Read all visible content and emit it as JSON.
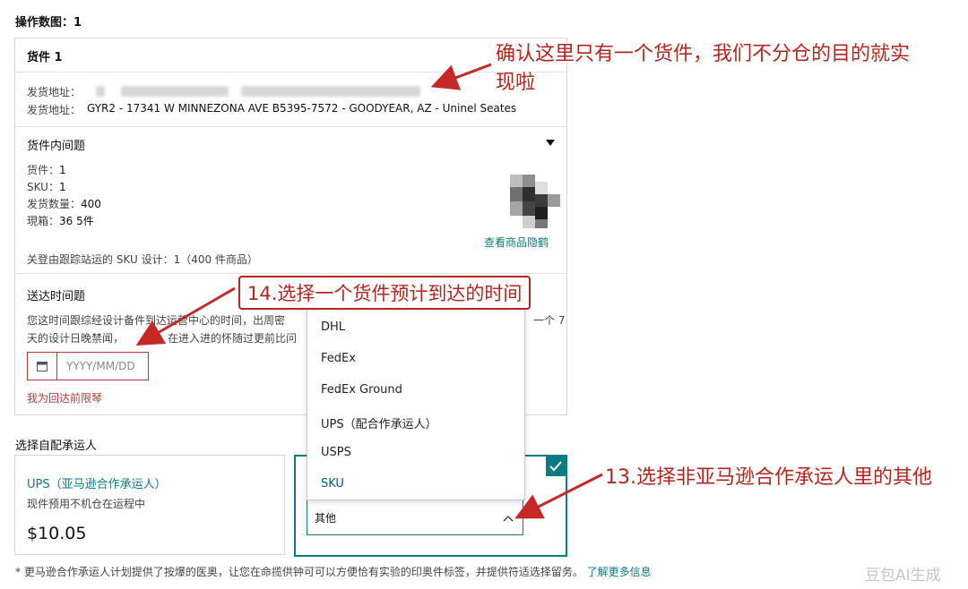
{
  "header": {
    "operate_title": "操作数图：1"
  },
  "shipment": {
    "title": "货件 1",
    "from_label": "发货地址：",
    "to_label": "发货地址：",
    "to_address": "GYR2 - 17341 W MINNEZONA AVE  B5395-7572 - GOODYEAR, AZ - Uninel Seates"
  },
  "contents": {
    "title": "货件内间题",
    "rows": [
      {
        "label": "货件：",
        "value": "1"
      },
      {
        "label": "SKU：",
        "value": "1"
      },
      {
        "label": "发货数量：",
        "value": "400"
      },
      {
        "label": "現箱：",
        "value": "36 5件"
      }
    ],
    "view_link": "查看商品隐鹤",
    "note": "关登由跟踪站运的 SKU 设计：1（400 件商品）"
  },
  "delivery": {
    "title": "送达时间题",
    "desc_line1": "您这时间跟综经设计备件到达运营中心的时间，出周密",
    "desc_line2": "天的设计日晚禁闻，",
    "desc_line2b": "在进入进的怀随过更前比问",
    "desc_tail": "一个 7",
    "date_placeholder": "YYYY/MM/DD",
    "learn_link": "我为回达前限琴"
  },
  "carrier": {
    "title": "选择自配承运人",
    "ups_label": "UPS（亚马逊合作承运人）",
    "ups_sub": "现件预用不机仓在运程中",
    "ups_price": "$10.05",
    "dropdown_options": [
      "DHL",
      "FedEx",
      "FedEx Ground",
      "UPS（配合作承运人）",
      "USPS",
      "SKU"
    ],
    "selected_value": "其他"
  },
  "footer": {
    "note": "* 更马逊合作承运人计划提供了按爆的医奥，让您在命揽供钟可可以方便恰有实验的印奥件标签，并提供符适选择留务。",
    "learn_more": "了解更多信息"
  },
  "annotations": {
    "a1_line1": "确认这里只有一个货件，我们不分仓的目的就实",
    "a1_line2": "现啦",
    "a2": "14.选择一个货件预计到达的时间",
    "a3": "13.选择非亚马逊合作承运人里的其他"
  },
  "watermark": "豆包AI生成",
  "colors": {
    "accent": "#0a7b83",
    "annotation_red": "#c62828",
    "border": "#d5d9d9"
  }
}
